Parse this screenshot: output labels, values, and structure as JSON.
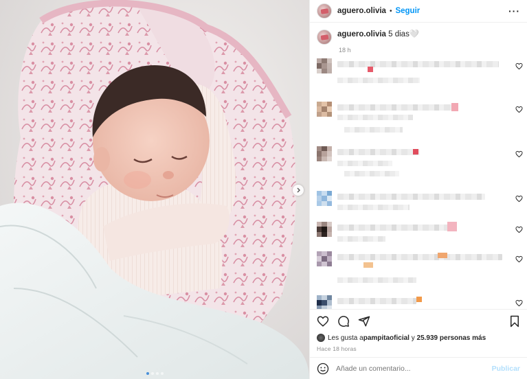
{
  "header": {
    "username": "aguero.olivia",
    "separator": "•",
    "follow_label": "Seguir",
    "more_label": "···"
  },
  "caption": {
    "username": "aguero.olivia",
    "text": "5 dias🤍",
    "time": "18 h"
  },
  "media": {
    "slide_count": 4,
    "active_slide": 1,
    "next_arrow": "›"
  },
  "likes": {
    "prefix": "Les gusta a ",
    "first_user": "pampitaoficial",
    "middle": " y ",
    "others": "25.939 personas más"
  },
  "timestamp": "Hace 18 horas",
  "add_comment": {
    "placeholder": "Añade un comentario...",
    "publish_label": "Publicar"
  },
  "icons": {
    "like": "heart-icon",
    "comment": "comment-icon",
    "share": "share-icon",
    "save": "bookmark-icon",
    "emoji": "emoji-icon",
    "next": "chevron-right-icon"
  },
  "colors": {
    "accent_blue": "#0095f6",
    "publish_disabled": "#b2dffc",
    "muted_text": "#8e8e8e"
  }
}
